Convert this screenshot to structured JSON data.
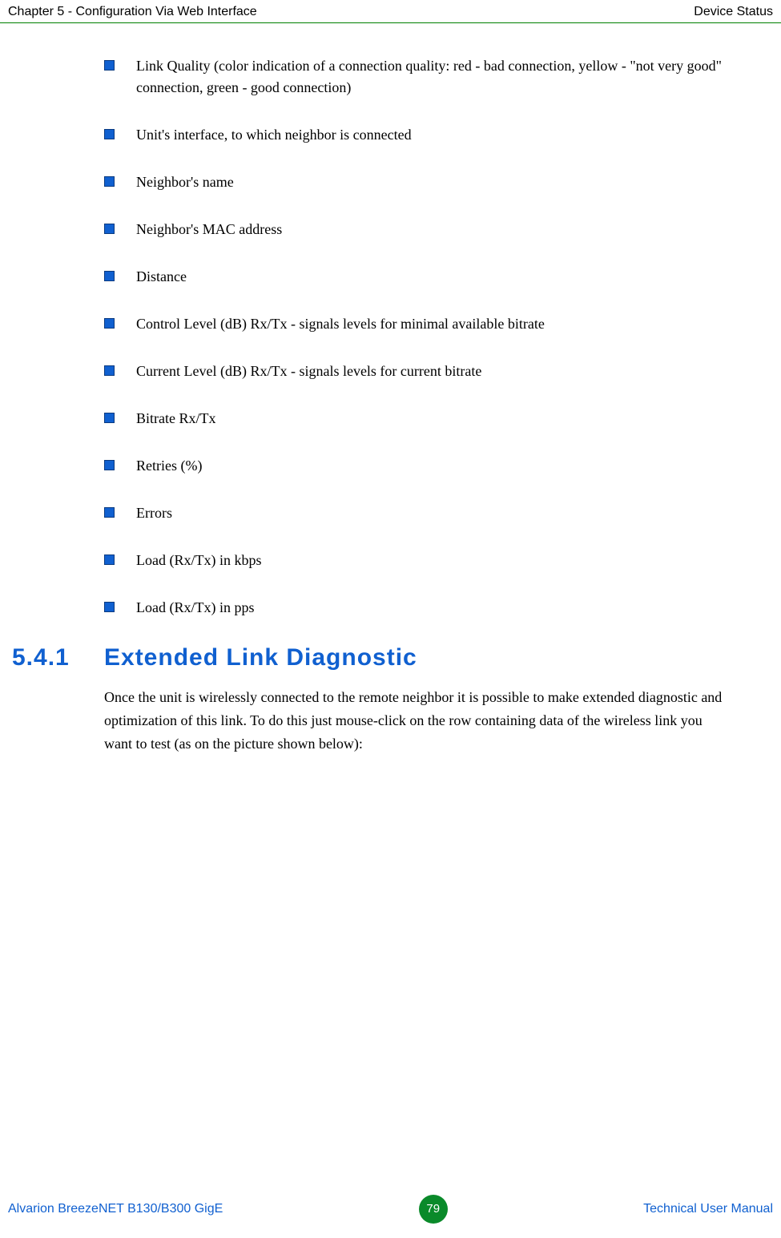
{
  "header": {
    "left": "Chapter 5 - Configuration Via Web Interface",
    "right": "Device Status"
  },
  "bullets": {
    "b0": "Link Quality (color indication of a connection quality: red - bad connection, yellow - \"not very good\" connection, green - good connection)",
    "b1": "Unit's interface, to which neighbor is connected",
    "b2": "Neighbor's name",
    "b3": "Neighbor's MAC address",
    "b4": "Distance",
    "b5": "Control Level (dB) Rx/Tx - signals levels for minimal available bitrate",
    "b6": "Current Level (dB) Rx/Tx - signals levels for current bitrate",
    "b7": "Bitrate Rx/Tx",
    "b8": "Retries (%)",
    "b9": "Errors",
    "b10": "Load (Rx/Tx) in kbps",
    "b11": "Load (Rx/Tx) in pps"
  },
  "section": {
    "number": "5.4.1",
    "title": "Extended Link Diagnostic",
    "body": "Once the unit is wirelessly connected to the remote neighbor it is possible to make extended diagnostic and optimization of this link. To do this just mouse-click on the row containing data of the wireless link you want to test (as on the picture shown below):"
  },
  "footer": {
    "left": "Alvarion BreezeNET B130/B300 GigE",
    "page": "79",
    "right": "Technical User Manual"
  }
}
